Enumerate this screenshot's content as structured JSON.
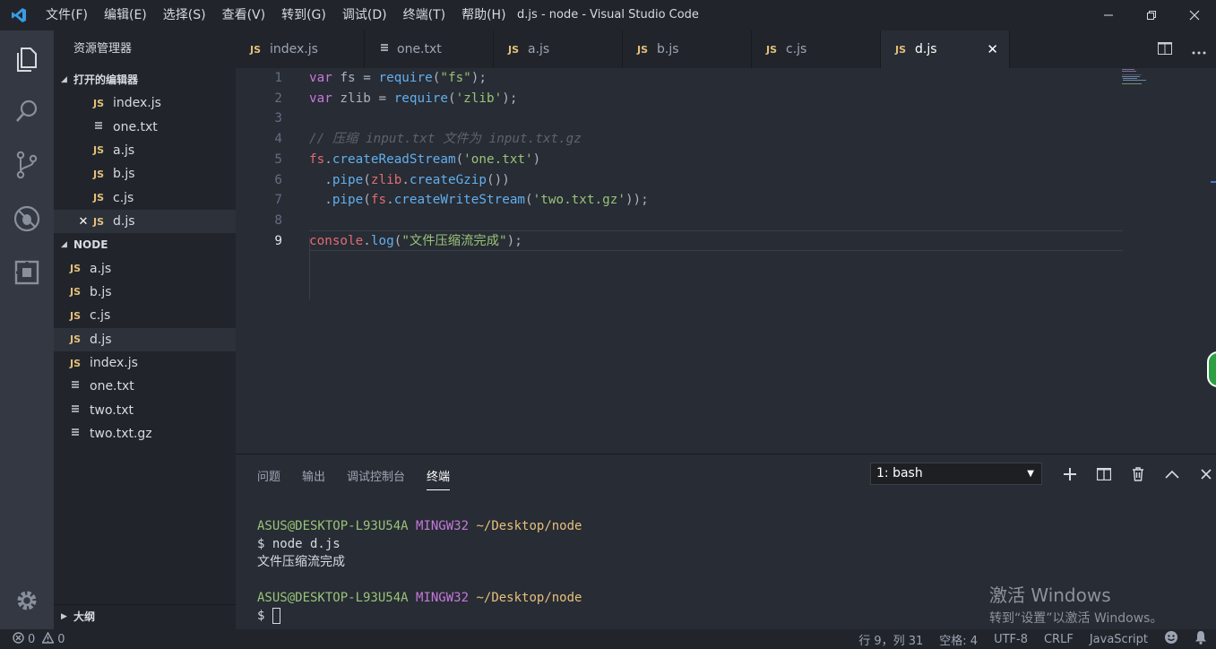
{
  "window": {
    "title": "d.js - node - Visual Studio Code",
    "menu": [
      "文件(F)",
      "编辑(E)",
      "选择(S)",
      "查看(V)",
      "转到(G)",
      "调试(D)",
      "终端(T)",
      "帮助(H)"
    ]
  },
  "sidebar": {
    "title": "资源管理器",
    "open_editors_label": "打开的编辑器",
    "open_editors": [
      {
        "name": "index.js",
        "type": "js"
      },
      {
        "name": "one.txt",
        "type": "txt"
      },
      {
        "name": "a.js",
        "type": "js"
      },
      {
        "name": "b.js",
        "type": "js"
      },
      {
        "name": "c.js",
        "type": "js"
      },
      {
        "name": "d.js",
        "type": "js",
        "close": "✕"
      }
    ],
    "folder_label": "NODE",
    "files": [
      {
        "name": "a.js",
        "type": "js"
      },
      {
        "name": "b.js",
        "type": "js"
      },
      {
        "name": "c.js",
        "type": "js"
      },
      {
        "name": "d.js",
        "type": "js"
      },
      {
        "name": "index.js",
        "type": "js"
      },
      {
        "name": "one.txt",
        "type": "txt"
      },
      {
        "name": "two.txt",
        "type": "txt"
      },
      {
        "name": "two.txt.gz",
        "type": "txt"
      }
    ],
    "outline_label": "大纲",
    "js_badge": "JS"
  },
  "tabs": [
    {
      "label": "index.js",
      "type": "js"
    },
    {
      "label": "one.txt",
      "type": "txt"
    },
    {
      "label": "a.js",
      "type": "js"
    },
    {
      "label": "b.js",
      "type": "js"
    },
    {
      "label": "c.js",
      "type": "js"
    },
    {
      "label": "d.js",
      "type": "js",
      "active": true,
      "close": "✕"
    }
  ],
  "editor": {
    "current_line": 9,
    "lines": [
      {
        "n": "1",
        "tokens": [
          [
            "kw",
            "var"
          ],
          [
            "pl",
            " fs = "
          ],
          [
            "fn",
            "require"
          ],
          [
            "pl",
            "("
          ],
          [
            "str",
            "\"fs\""
          ],
          [
            "pl",
            ");"
          ]
        ]
      },
      {
        "n": "2",
        "tokens": [
          [
            "kw",
            "var"
          ],
          [
            "pl",
            " zlib = "
          ],
          [
            "fn",
            "require"
          ],
          [
            "pl",
            "("
          ],
          [
            "str",
            "'zlib'"
          ],
          [
            "pl",
            ");"
          ]
        ]
      },
      {
        "n": "3",
        "tokens": []
      },
      {
        "n": "4",
        "tokens": [
          [
            "cm",
            "// 压缩 input.txt 文件为 input.txt.gz"
          ]
        ]
      },
      {
        "n": "5",
        "tokens": [
          [
            "id",
            "fs"
          ],
          [
            "pl",
            "."
          ],
          [
            "fn",
            "createReadStream"
          ],
          [
            "pl",
            "("
          ],
          [
            "str",
            "'one.txt'"
          ],
          [
            "pl",
            ")"
          ]
        ]
      },
      {
        "n": "6",
        "tokens": [
          [
            "pl",
            "  ."
          ],
          [
            "fn",
            "pipe"
          ],
          [
            "pl",
            "("
          ],
          [
            "id",
            "zlib"
          ],
          [
            "pl",
            "."
          ],
          [
            "fn",
            "createGzip"
          ],
          [
            "pl",
            "())"
          ]
        ]
      },
      {
        "n": "7",
        "tokens": [
          [
            "pl",
            "  ."
          ],
          [
            "fn",
            "pipe"
          ],
          [
            "pl",
            "("
          ],
          [
            "id",
            "fs"
          ],
          [
            "pl",
            "."
          ],
          [
            "fn",
            "createWriteStream"
          ],
          [
            "pl",
            "("
          ],
          [
            "str",
            "'two.txt.gz'"
          ],
          [
            "pl",
            "));"
          ]
        ]
      },
      {
        "n": "8",
        "tokens": []
      },
      {
        "n": "9",
        "tokens": [
          [
            "id",
            "console"
          ],
          [
            "pl",
            "."
          ],
          [
            "fn",
            "log"
          ],
          [
            "pl",
            "("
          ],
          [
            "str",
            "\"文件压缩流完成\""
          ],
          [
            "pl",
            ");"
          ]
        ]
      }
    ]
  },
  "panel": {
    "tabs": [
      "问题",
      "输出",
      "调试控制台",
      "终端"
    ],
    "active_tab": "终端",
    "terminal_select": "1: bash",
    "terminal": {
      "user": "ASUS@DESKTOP-L93U54A",
      "env": "MINGW32",
      "path": "~/Desktop/node",
      "command": "$ node d.js",
      "output": "文件压缩流完成",
      "prompt": "$ "
    }
  },
  "watermark": {
    "line1": "激活 Windows",
    "line2": "转到“设置”以激活 Windows。"
  },
  "status": {
    "errors": "0",
    "warnings": "0",
    "position": "行 9，列 31",
    "spaces": "空格: 4",
    "encoding": "UTF-8",
    "eol": "CRLF",
    "language": "JavaScript"
  }
}
